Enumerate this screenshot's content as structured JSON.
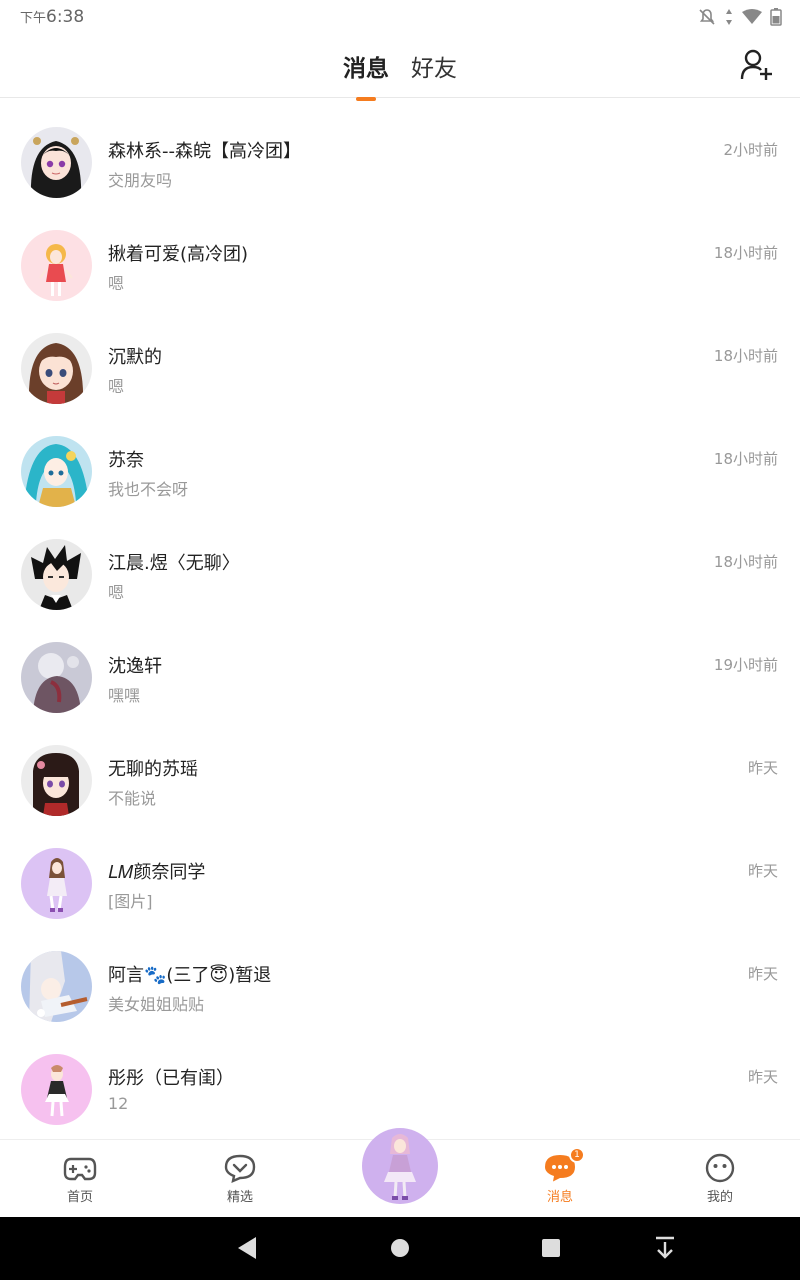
{
  "status_bar": {
    "ampm": "下午",
    "time": "6:38"
  },
  "header": {
    "tabs": [
      {
        "label": "消息",
        "active": true
      },
      {
        "label": "好友",
        "active": false
      }
    ],
    "add_friend_icon": "person-add-icon"
  },
  "conversations": [
    {
      "name": "森林系--森皖【高冷团】",
      "preview": "交朋友吗",
      "time": "2小时前"
    },
    {
      "name": "揪着可爱(高冷团)",
      "preview": "嗯",
      "time": "18小时前"
    },
    {
      "name": "沉默的",
      "preview": "嗯",
      "time": "18小时前"
    },
    {
      "name": "苏奈",
      "preview": "我也不会呀",
      "time": "18小时前"
    },
    {
      "name": "江晨.煜〈无聊〉",
      "preview": "嗯",
      "time": "18小时前"
    },
    {
      "name": "沈逸轩",
      "preview": "嘿嘿",
      "time": "19小时前"
    },
    {
      "name": "无聊的苏瑶",
      "preview": "不能说",
      "time": "昨天"
    },
    {
      "name": "𝐿𝑀颜奈同学",
      "preview": "[图片]",
      "time": "昨天"
    },
    {
      "name": "阿言🐾(三了😇)暂退",
      "preview": "美女姐姐贴贴",
      "time": "昨天"
    },
    {
      "name": "彤彤（已有闺）",
      "preview": "12",
      "time": "昨天"
    }
  ],
  "bottom_nav": [
    {
      "label": "首页",
      "icon": "gamepad-icon"
    },
    {
      "label": "精选",
      "icon": "heart-chat-icon"
    },
    {
      "label": "消息",
      "icon": "message-icon",
      "badge": "1",
      "active": true
    },
    {
      "label": "我的",
      "icon": "face-icon"
    }
  ],
  "colors": {
    "accent": "#f57c1f",
    "text_muted": "#999999"
  }
}
